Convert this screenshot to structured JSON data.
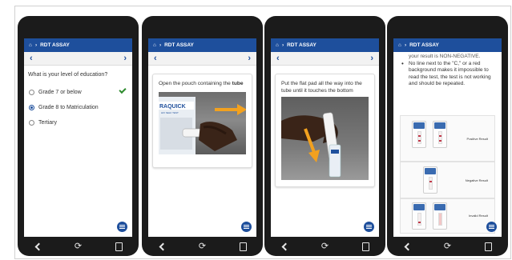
{
  "header": {
    "title": "RDT ASSAY"
  },
  "screens": [
    {
      "question": "What is your level of education?",
      "options": [
        "Grade 7 or below",
        "Grade 8 to Matriculation",
        "Tertiary"
      ],
      "selected_index": 1
    },
    {
      "instruction_pre": "Open the pouch containing the ",
      "instruction_bold": "tube",
      "image_label": "RAQUICK",
      "image_sublabel": "HIV SELF TEST"
    },
    {
      "instruction": "Put the flat pad all the way into the tube until it touches the bottom"
    },
    {
      "truncated_line": "your result is NON-NEGATIVE.",
      "bullet": "No line next to the \"C,\" or a red background makes it impossible to read the test, the test is not working and should be repeated.",
      "results": [
        "Positive Result",
        "Negative Result",
        "Invalid Result"
      ],
      "line_labels": [
        "C",
        "T"
      ]
    }
  ],
  "nav": {
    "back_icon": "chevron-left-icon",
    "forward_icon": "chevron-right-icon",
    "menu_icon": "menu-icon"
  },
  "colors": {
    "header_blue": "#1e4f9c",
    "check_green": "#2e8b2e"
  }
}
